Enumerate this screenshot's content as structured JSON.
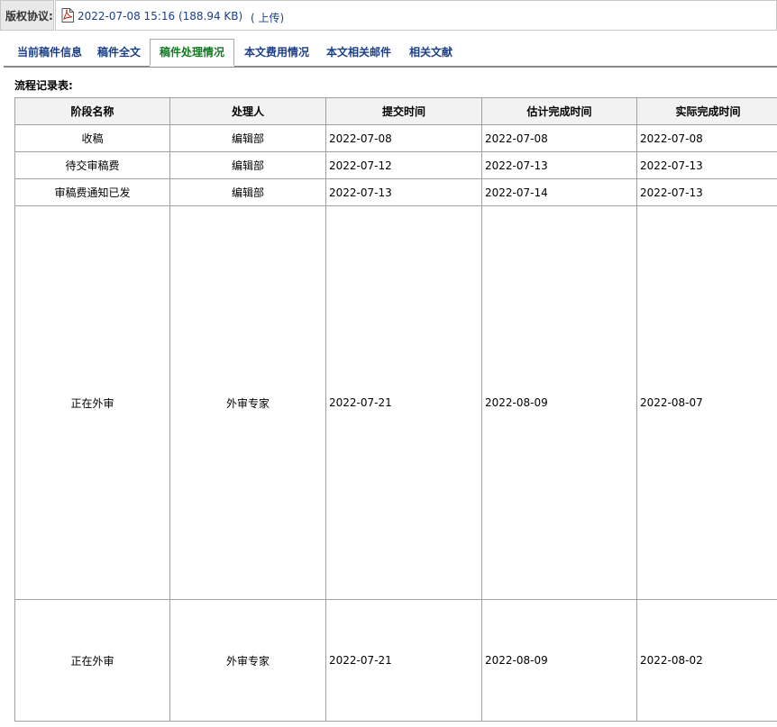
{
  "copyright": {
    "label": "版权协议:",
    "file_text": "2022-07-08 15:16 (188.94 KB)",
    "upload_text": "( 上传)"
  },
  "tabs": [
    {
      "label": "当前稿件信息",
      "active": false
    },
    {
      "label": "稿件全文",
      "active": false
    },
    {
      "label": "稿件处理情况",
      "active": true
    },
    {
      "label": "本文费用情况",
      "active": false
    },
    {
      "label": "本文相关邮件",
      "active": false
    },
    {
      "label": "相关文献",
      "active": false
    }
  ],
  "section_title": "流程记录表:",
  "table": {
    "headers": [
      "阶段名称",
      "处理人",
      "提交时间",
      "估计完成时间",
      "实际完成时间"
    ],
    "rows": [
      [
        "收稿",
        "编辑部",
        "2022-07-08",
        "2022-07-08",
        "2022-07-08"
      ],
      [
        "待交审稿费",
        "编辑部",
        "2022-07-12",
        "2022-07-13",
        "2022-07-13"
      ],
      [
        "审稿费通知已发",
        "编辑部",
        "2022-07-13",
        "2022-07-14",
        "2022-07-13"
      ],
      [
        "正在外审",
        "外审专家",
        "2022-07-21",
        "2022-08-09",
        "2022-08-07"
      ],
      [
        "正在外审",
        "外审专家",
        "2022-07-21",
        "2022-08-09",
        "2022-08-02"
      ]
    ]
  },
  "colors": {
    "link": "#1a3f8a",
    "active_tab": "#0f7a20",
    "border": "#a0a0a0"
  },
  "icons": {
    "file": "pdf-icon"
  }
}
